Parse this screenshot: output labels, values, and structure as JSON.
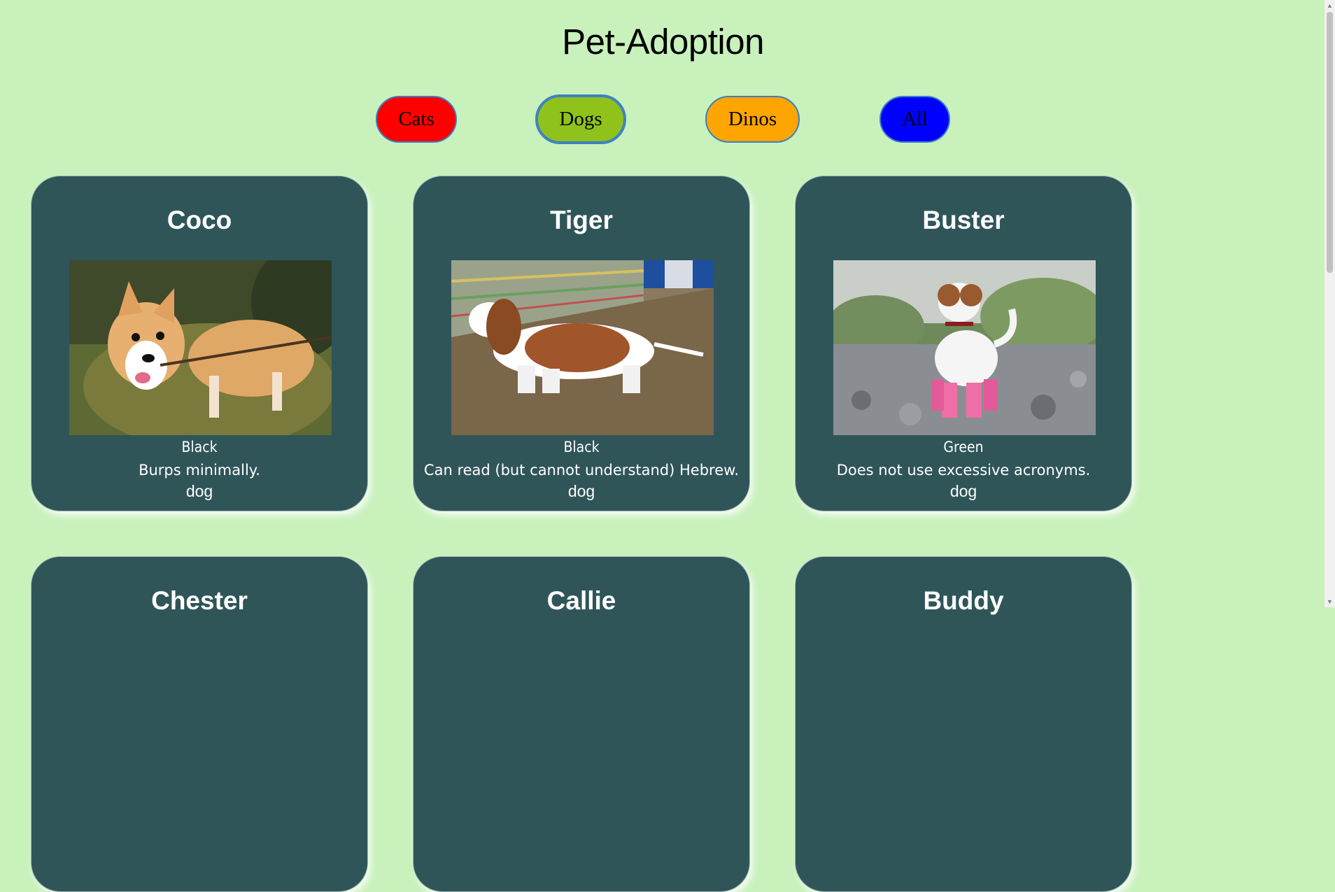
{
  "page": {
    "title": "Pet-Adoption"
  },
  "filters": [
    {
      "label": "Cats",
      "color": "#ff0000"
    },
    {
      "label": "Dogs",
      "color": "#8fc21b"
    },
    {
      "label": "Dinos",
      "color": "#ffa500"
    },
    {
      "label": "All",
      "color": "#0000ff"
    }
  ],
  "pets": [
    {
      "name": "Coco",
      "color": "Black",
      "description": "Burps minimally.",
      "type": "dog",
      "image": "corgi-with-stick"
    },
    {
      "name": "Tiger",
      "color": "Black",
      "description": "Can read (but cannot understand) Hebrew.",
      "type": "dog",
      "image": "basset-hound"
    },
    {
      "name": "Buster",
      "color": "Green",
      "description": "Does not use excessive acronyms.",
      "type": "dog",
      "image": "terrier-in-pink-boots"
    },
    {
      "name": "Chester"
    },
    {
      "name": "Callie"
    },
    {
      "name": "Buddy"
    }
  ],
  "theme": {
    "background": "#c8f1bc",
    "card": "#2f5559"
  }
}
